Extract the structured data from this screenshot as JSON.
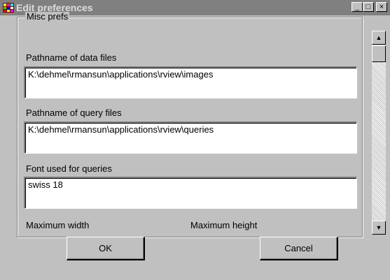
{
  "window": {
    "title": "Edit preferences",
    "controls": {
      "minimize": "_",
      "maximize": "□",
      "close": "×"
    }
  },
  "group": {
    "label": "Misc prefs"
  },
  "fields": [
    {
      "label": "Pathname of data files",
      "value": "K:\\dehmel\\rmansun\\applications\\rview\\images"
    },
    {
      "label": "Pathname of query files",
      "value": "K:\\dehmel\\rmansun\\applications\\rview\\queries"
    },
    {
      "label": "Font used for queries",
      "value": "swiss 18"
    }
  ],
  "size_labels": {
    "max_width": "Maximum width",
    "max_height": "Maximum height"
  },
  "scrollbar": {
    "up": "▲",
    "down": "▼"
  },
  "buttons": {
    "ok": "OK",
    "cancel": "Cancel"
  }
}
